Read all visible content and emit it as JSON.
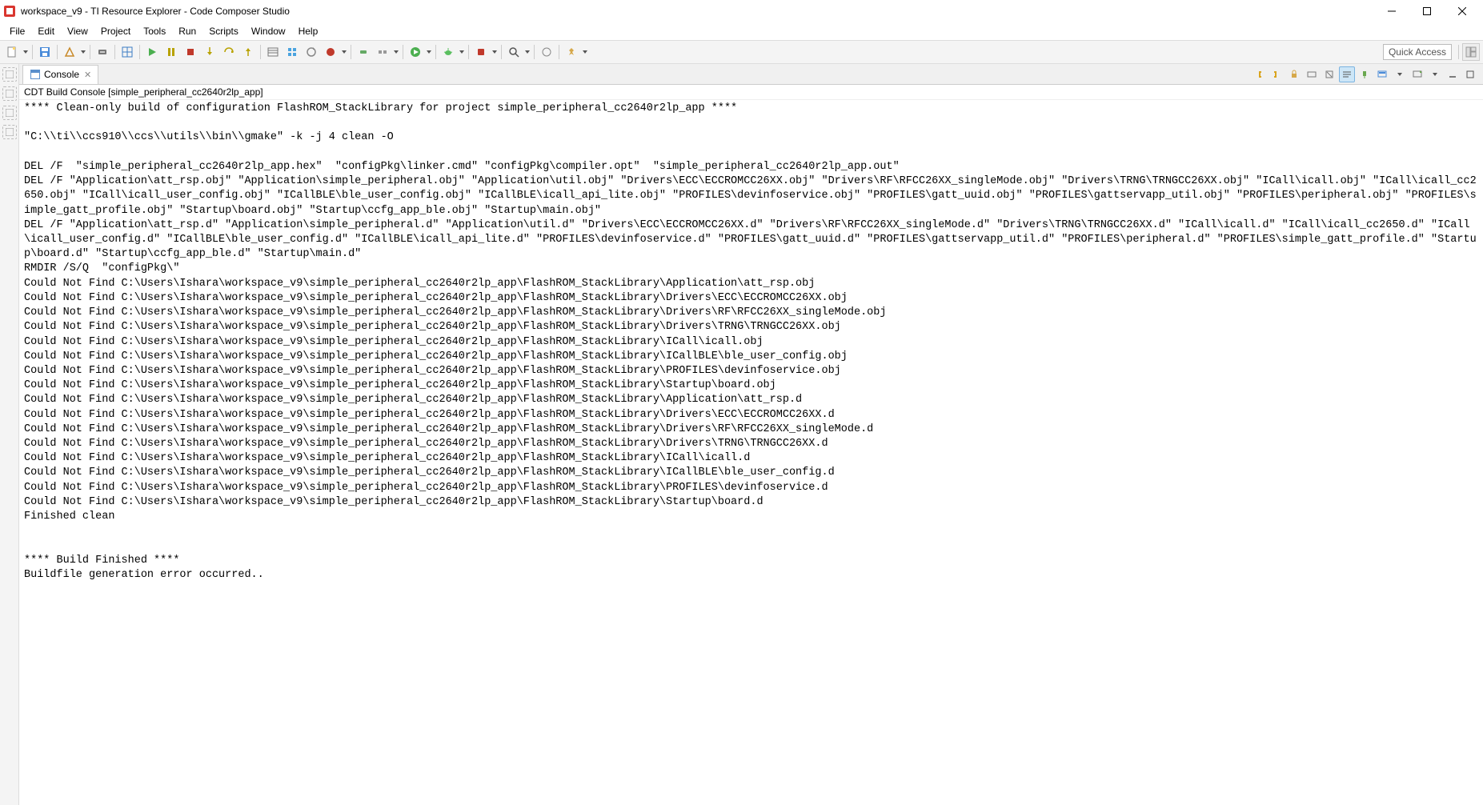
{
  "titlebar": {
    "title": "workspace_v9 - TI Resource Explorer - Code Composer Studio"
  },
  "menu": {
    "items": [
      "File",
      "Edit",
      "View",
      "Project",
      "Tools",
      "Run",
      "Scripts",
      "Window",
      "Help"
    ]
  },
  "toolbar": {
    "quick_access_placeholder": "Quick Access"
  },
  "console": {
    "tab_label": "Console",
    "header": "CDT Build Console [simple_peripheral_cc2640r2lp_app]",
    "lines": [
      "**** Clean-only build of configuration FlashROM_StackLibrary for project simple_peripheral_cc2640r2lp_app ****",
      "",
      "\"C:\\\\ti\\\\ccs910\\\\ccs\\\\utils\\\\bin\\\\gmake\" -k -j 4 clean -O ",
      "",
      "DEL /F  \"simple_peripheral_cc2640r2lp_app.hex\"  \"configPkg\\linker.cmd\" \"configPkg\\compiler.opt\"  \"simple_peripheral_cc2640r2lp_app.out\" ",
      "DEL /F \"Application\\att_rsp.obj\" \"Application\\simple_peripheral.obj\" \"Application\\util.obj\" \"Drivers\\ECC\\ECCROMCC26XX.obj\" \"Drivers\\RF\\RFCC26XX_singleMode.obj\" \"Drivers\\TRNG\\TRNGCC26XX.obj\" \"ICall\\icall.obj\" \"ICall\\icall_cc2650.obj\" \"ICall\\icall_user_config.obj\" \"ICallBLE\\ble_user_config.obj\" \"ICallBLE\\icall_api_lite.obj\" \"PROFILES\\devinfoservice.obj\" \"PROFILES\\gatt_uuid.obj\" \"PROFILES\\gattservapp_util.obj\" \"PROFILES\\peripheral.obj\" \"PROFILES\\simple_gatt_profile.obj\" \"Startup\\board.obj\" \"Startup\\ccfg_app_ble.obj\" \"Startup\\main.obj\" ",
      "DEL /F \"Application\\att_rsp.d\" \"Application\\simple_peripheral.d\" \"Application\\util.d\" \"Drivers\\ECC\\ECCROMCC26XX.d\" \"Drivers\\RF\\RFCC26XX_singleMode.d\" \"Drivers\\TRNG\\TRNGCC26XX.d\" \"ICall\\icall.d\" \"ICall\\icall_cc2650.d\" \"ICall\\icall_user_config.d\" \"ICallBLE\\ble_user_config.d\" \"ICallBLE\\icall_api_lite.d\" \"PROFILES\\devinfoservice.d\" \"PROFILES\\gatt_uuid.d\" \"PROFILES\\gattservapp_util.d\" \"PROFILES\\peripheral.d\" \"PROFILES\\simple_gatt_profile.d\" \"Startup\\board.d\" \"Startup\\ccfg_app_ble.d\" \"Startup\\main.d\" ",
      "RMDIR /S/Q  \"configPkg\\\" ",
      "Could Not Find C:\\Users\\Ishara\\workspace_v9\\simple_peripheral_cc2640r2lp_app\\FlashROM_StackLibrary\\Application\\att_rsp.obj",
      "Could Not Find C:\\Users\\Ishara\\workspace_v9\\simple_peripheral_cc2640r2lp_app\\FlashROM_StackLibrary\\Drivers\\ECC\\ECCROMCC26XX.obj",
      "Could Not Find C:\\Users\\Ishara\\workspace_v9\\simple_peripheral_cc2640r2lp_app\\FlashROM_StackLibrary\\Drivers\\RF\\RFCC26XX_singleMode.obj",
      "Could Not Find C:\\Users\\Ishara\\workspace_v9\\simple_peripheral_cc2640r2lp_app\\FlashROM_StackLibrary\\Drivers\\TRNG\\TRNGCC26XX.obj",
      "Could Not Find C:\\Users\\Ishara\\workspace_v9\\simple_peripheral_cc2640r2lp_app\\FlashROM_StackLibrary\\ICall\\icall.obj",
      "Could Not Find C:\\Users\\Ishara\\workspace_v9\\simple_peripheral_cc2640r2lp_app\\FlashROM_StackLibrary\\ICallBLE\\ble_user_config.obj",
      "Could Not Find C:\\Users\\Ishara\\workspace_v9\\simple_peripheral_cc2640r2lp_app\\FlashROM_StackLibrary\\PROFILES\\devinfoservice.obj",
      "Could Not Find C:\\Users\\Ishara\\workspace_v9\\simple_peripheral_cc2640r2lp_app\\FlashROM_StackLibrary\\Startup\\board.obj",
      "Could Not Find C:\\Users\\Ishara\\workspace_v9\\simple_peripheral_cc2640r2lp_app\\FlashROM_StackLibrary\\Application\\att_rsp.d",
      "Could Not Find C:\\Users\\Ishara\\workspace_v9\\simple_peripheral_cc2640r2lp_app\\FlashROM_StackLibrary\\Drivers\\ECC\\ECCROMCC26XX.d",
      "Could Not Find C:\\Users\\Ishara\\workspace_v9\\simple_peripheral_cc2640r2lp_app\\FlashROM_StackLibrary\\Drivers\\RF\\RFCC26XX_singleMode.d",
      "Could Not Find C:\\Users\\Ishara\\workspace_v9\\simple_peripheral_cc2640r2lp_app\\FlashROM_StackLibrary\\Drivers\\TRNG\\TRNGCC26XX.d",
      "Could Not Find C:\\Users\\Ishara\\workspace_v9\\simple_peripheral_cc2640r2lp_app\\FlashROM_StackLibrary\\ICall\\icall.d",
      "Could Not Find C:\\Users\\Ishara\\workspace_v9\\simple_peripheral_cc2640r2lp_app\\FlashROM_StackLibrary\\ICallBLE\\ble_user_config.d",
      "Could Not Find C:\\Users\\Ishara\\workspace_v9\\simple_peripheral_cc2640r2lp_app\\FlashROM_StackLibrary\\PROFILES\\devinfoservice.d",
      "Could Not Find C:\\Users\\Ishara\\workspace_v9\\simple_peripheral_cc2640r2lp_app\\FlashROM_StackLibrary\\Startup\\board.d",
      "Finished clean",
      "",
      "",
      "**** Build Finished ****",
      "Buildfile generation error occurred.."
    ]
  }
}
